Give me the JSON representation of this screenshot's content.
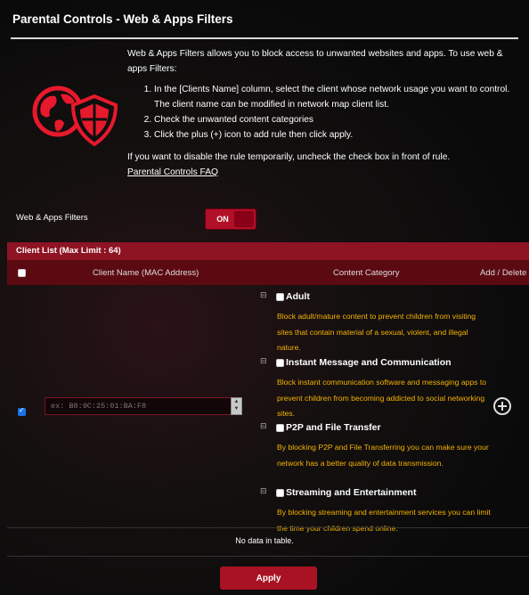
{
  "page": {
    "title": "Parental Controls - Web & Apps Filters"
  },
  "description": {
    "intro": "Web & Apps Filters allows you to block access to unwanted websites and apps. To use web & apps Filters:",
    "steps": [
      "In the [Clients Name] column, select the client whose network usage you want to control. The client name can be modified in network map client list.",
      "Check the unwanted content categories",
      "Click the plus (+) icon to add rule then click apply."
    ],
    "note": "If you want to disable the rule temporarily, uncheck the check box in front of rule.",
    "faq_link": "Parental Controls FAQ"
  },
  "web_apps_filters": {
    "label": "Web & Apps Filters",
    "toggle_state": "ON"
  },
  "client_list": {
    "header": "Client List (Max Limit : 64)",
    "columns": {
      "client_name": "Client Name (MAC Address)",
      "content_category": "Content Category",
      "add_delete": "Add / Delete"
    },
    "mac_placeholder": "ex: B8:9C:25:01:BA:F8",
    "categories": [
      {
        "name": "Adult",
        "text": "Block adult/mature content to prevent children from visiting sites that contain material of a sexual, violent, and illegal nature."
      },
      {
        "name": "Instant Message and Communication",
        "text": "Block instant communication software and messaging apps to prevent children from becoming addicted to social networking sites."
      },
      {
        "name": "P2P and File Transfer",
        "text": "By blocking P2P and File Transferring you can make sure your network has a better quality of data transmission."
      },
      {
        "name": "Streaming and Entertainment",
        "text": "By blocking streaming and entertainment services you can limit the time your children spend online."
      }
    ],
    "empty_message": "No data in table."
  },
  "apply_label": "Apply",
  "colors": {
    "accent": "#a81222",
    "header_red": "#8e1423",
    "category_text": "#f5b300"
  }
}
